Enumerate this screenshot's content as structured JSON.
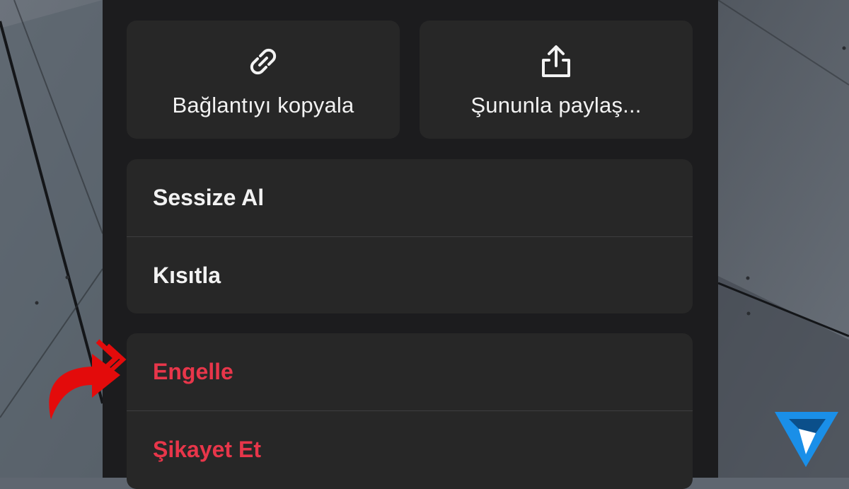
{
  "quick_actions": [
    {
      "label": "Bağlantıyı kopyala",
      "icon": "link-icon"
    },
    {
      "label": "Şununla paylaş...",
      "icon": "share-icon"
    }
  ],
  "moderation_menu": {
    "items": [
      {
        "label": "Sessize Al"
      },
      {
        "label": "Kısıtla"
      }
    ]
  },
  "danger_menu": {
    "items": [
      {
        "label": "Engelle",
        "color": "#e8364a"
      },
      {
        "label": "Şikayet Et",
        "color": "#e8364a"
      }
    ]
  },
  "colors": {
    "sheet_background": "#1c1c1e",
    "card_background": "#272727",
    "text_primary": "#f2f2f2",
    "danger": "#e8364a",
    "annotation_arrow": "#e30b0b",
    "watermark_logo": "#1a8fe8"
  },
  "annotation": {
    "icon": "red-curved-arrow-icon",
    "points_to": "Engelle"
  },
  "watermark": {
    "icon": "brand-logo-icon"
  }
}
